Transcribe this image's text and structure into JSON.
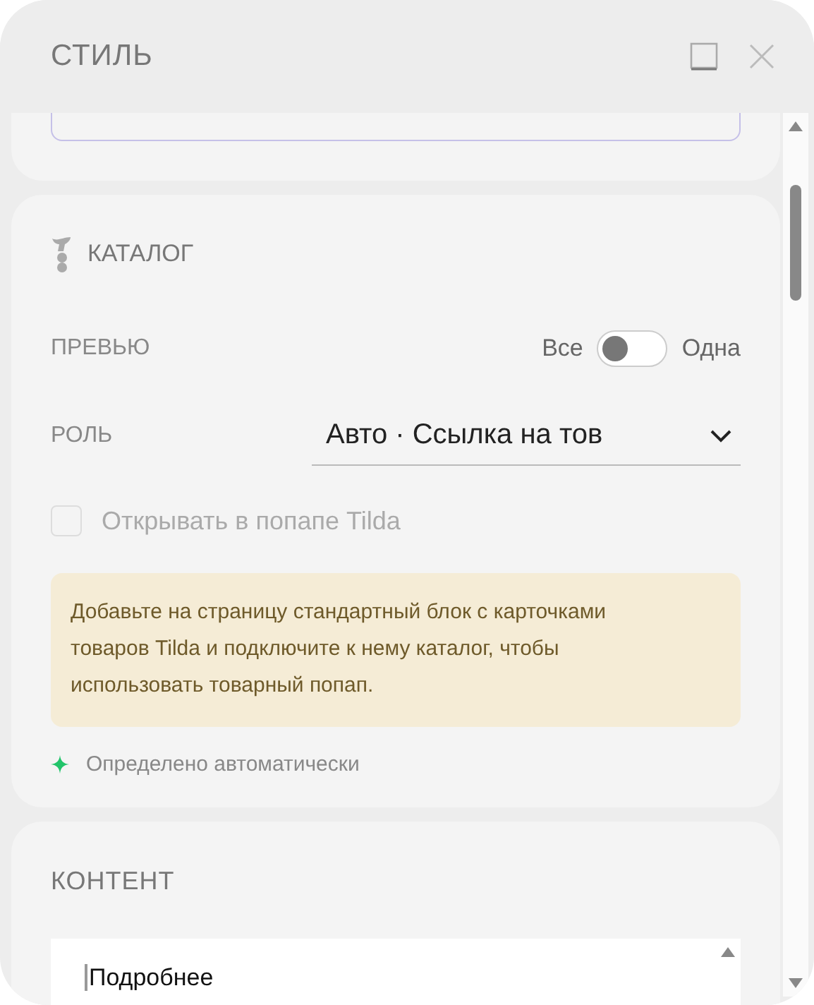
{
  "window": {
    "title": "СТИЛЬ"
  },
  "catalog": {
    "title": "КАТАЛОГ",
    "preview": {
      "label": "ПРЕВЬЮ",
      "option_left": "Все",
      "option_right": "Одна",
      "on": false
    },
    "role": {
      "label": "РОЛЬ",
      "value": "Авто · Ссылка на тов"
    },
    "popup_checkbox": {
      "label": "Открывать в попапе Tilda",
      "checked": false,
      "disabled": true
    },
    "notice": "Добавьте на страницу стандартный блок с карточками товаров Tilda и подключите к нему каталог, чтобы использовать товарный попап.",
    "auto_note": "Определено автоматически"
  },
  "content": {
    "title": "КОНТЕНТ",
    "value": "Подробнее"
  }
}
